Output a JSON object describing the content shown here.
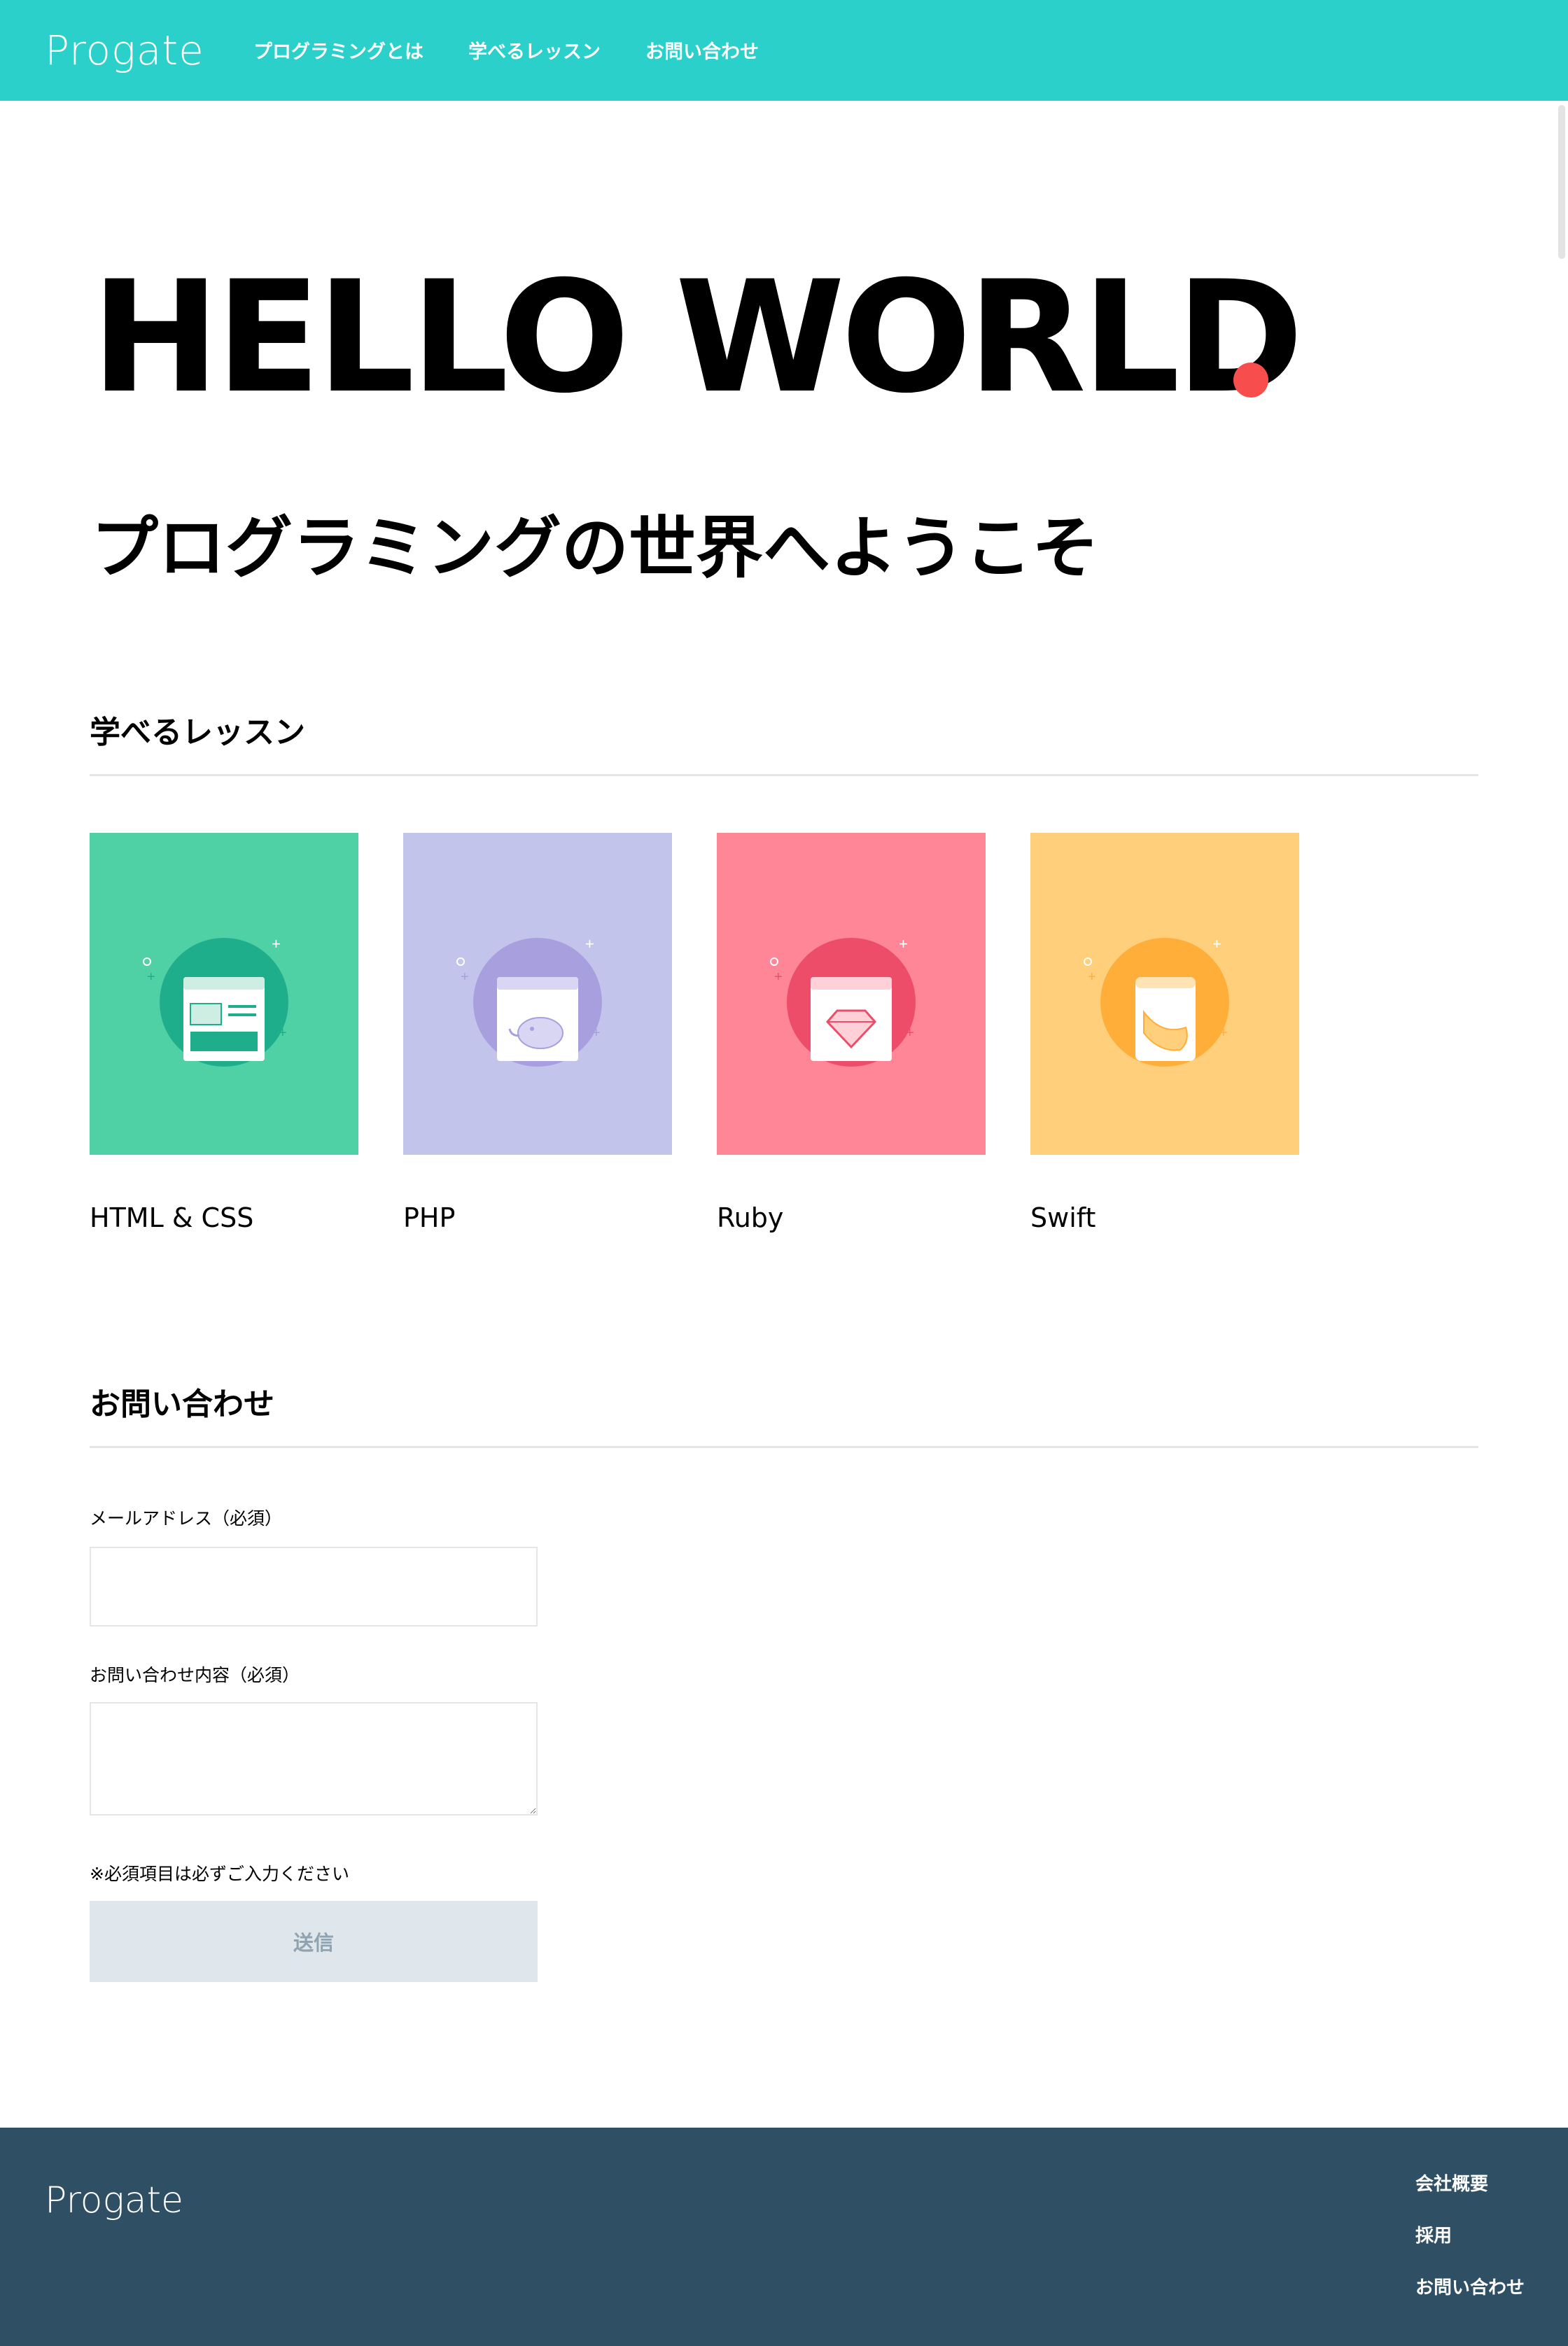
{
  "header": {
    "logo": "Progate",
    "nav": [
      "プログラミングとは",
      "学べるレッスン",
      "お問い合わせ"
    ],
    "background": "#2ad0c9"
  },
  "hero": {
    "title": "HELLO WORLD",
    "dot_color": "#f74d4d",
    "subtitle": "プログラミングの世界へようこそ"
  },
  "lessons": {
    "heading": "学べるレッスン",
    "items": [
      {
        "name": "HTML & CSS",
        "bg": "#4fd1a5",
        "circle": "#1fae8c",
        "icon": "browser-layout-icon"
      },
      {
        "name": "PHP",
        "bg": "#c3c4eb",
        "circle": "#a8a0de",
        "icon": "elephant-icon"
      },
      {
        "name": "Ruby",
        "bg": "#ff8696",
        "circle": "#ee4d69",
        "icon": "ruby-gem-icon"
      },
      {
        "name": "Swift",
        "bg": "#ffcf7b",
        "circle": "#ffae3a",
        "icon": "swift-bird-icon"
      }
    ]
  },
  "contact": {
    "heading": "お問い合わせ",
    "email_label": "メールアドレス（必須）",
    "email_value": "",
    "message_label": "お問い合わせ内容（必須）",
    "message_value": "",
    "note": "※必須項目は必ずご入力ください",
    "submit_label": "送信"
  },
  "footer": {
    "logo": "Progate",
    "links": [
      "会社概要",
      "採用",
      "お問い合わせ"
    ],
    "background": "#2f4f65"
  }
}
